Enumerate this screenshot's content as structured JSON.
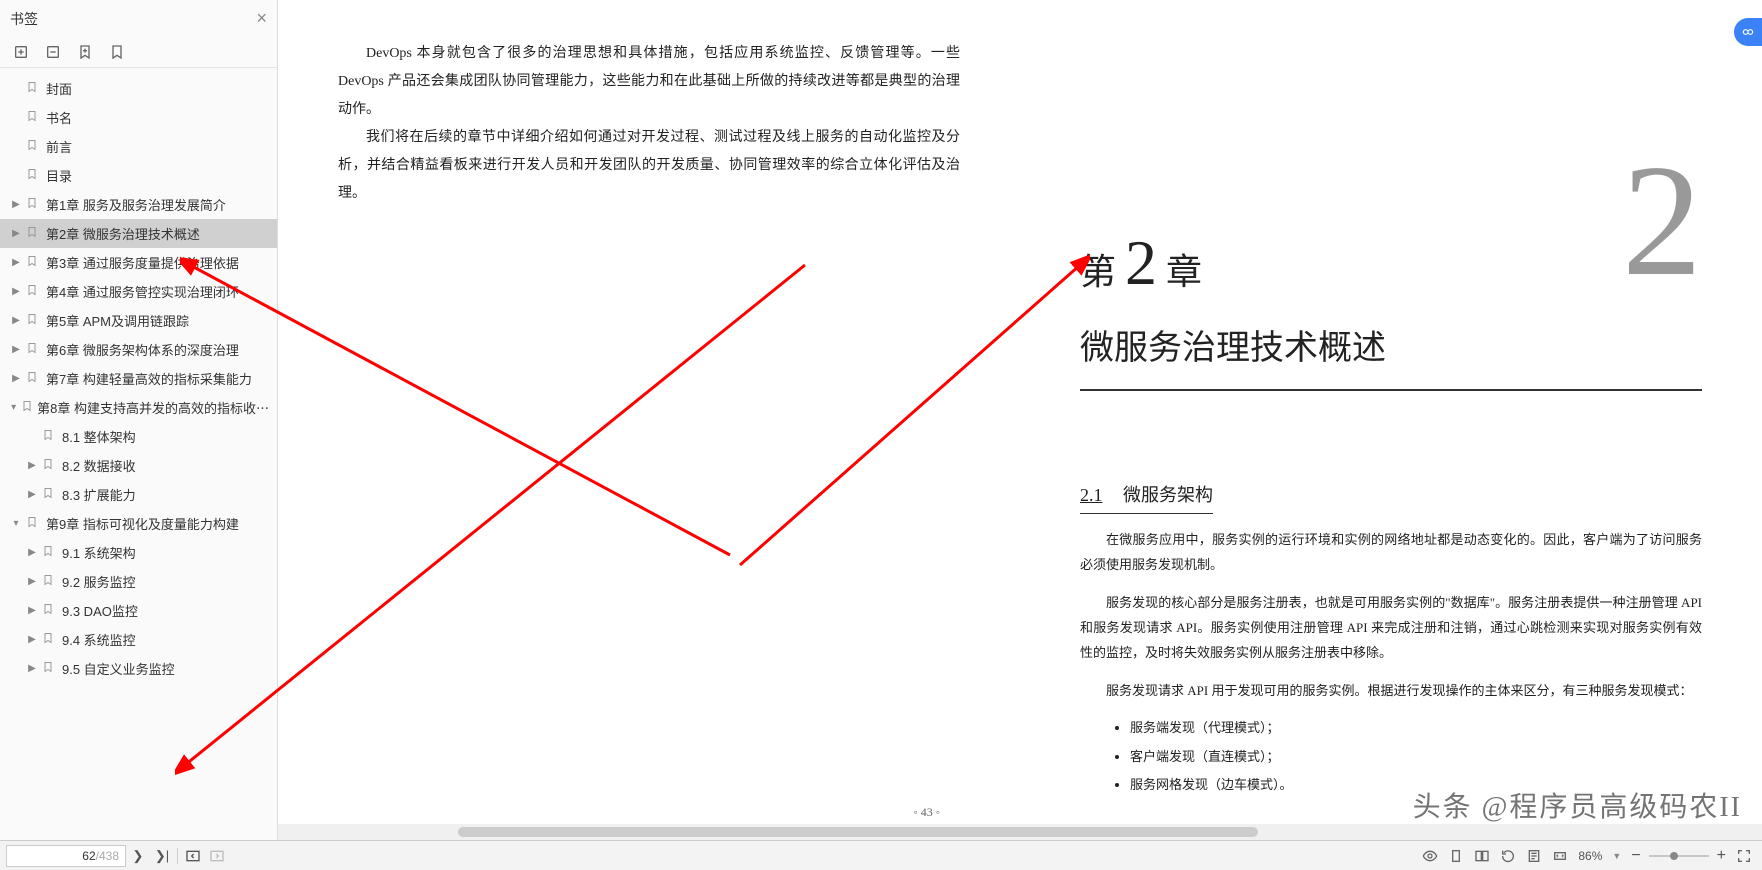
{
  "sidebar": {
    "title": "书签",
    "items": [
      {
        "level": 1,
        "label": "封面",
        "expandable": false
      },
      {
        "level": 1,
        "label": "书名",
        "expandable": false
      },
      {
        "level": 1,
        "label": "前言",
        "expandable": false
      },
      {
        "level": 1,
        "label": "目录",
        "expandable": false
      },
      {
        "level": 1,
        "label": "第1章 服务及服务治理发展简介",
        "expandable": true,
        "arrow": "▶"
      },
      {
        "level": 1,
        "label": "第2章 微服务治理技术概述",
        "expandable": true,
        "arrow": "▶",
        "selected": true
      },
      {
        "level": 1,
        "label": "第3章 通过服务度量提供治理依据",
        "expandable": true,
        "arrow": "▶"
      },
      {
        "level": 1,
        "label": "第4章 通过服务管控实现治理闭环",
        "expandable": true,
        "arrow": "▶"
      },
      {
        "level": 1,
        "label": "第5章 APM及调用链跟踪",
        "expandable": true,
        "arrow": "▶"
      },
      {
        "level": 1,
        "label": "第6章 微服务架构体系的深度治理",
        "expandable": true,
        "arrow": "▶"
      },
      {
        "level": 1,
        "label": "第7章 构建轻量高效的指标采集能力",
        "expandable": true,
        "arrow": "▶"
      },
      {
        "level": 1,
        "label": "第8章 构建支持高并发的高效的指标收⋯",
        "expandable": true,
        "arrow": "▾"
      },
      {
        "level": 2,
        "label": "8.1 整体架构",
        "expandable": false
      },
      {
        "level": 2,
        "label": "8.2 数据接收",
        "expandable": true,
        "arrow": "▶"
      },
      {
        "level": 2,
        "label": "8.3 扩展能力",
        "expandable": true,
        "arrow": "▶"
      },
      {
        "level": 1,
        "label": "第9章 指标可视化及度量能力构建",
        "expandable": true,
        "arrow": "▾"
      },
      {
        "level": 2,
        "label": "9.1 系统架构",
        "expandable": true,
        "arrow": "▶"
      },
      {
        "level": 2,
        "label": "9.2 服务监控",
        "expandable": true,
        "arrow": "▶"
      },
      {
        "level": 2,
        "label": "9.3 DAO监控",
        "expandable": true,
        "arrow": "▶"
      },
      {
        "level": 2,
        "label": "9.4 系统监控",
        "expandable": true,
        "arrow": "▶"
      },
      {
        "level": 2,
        "label": "9.5 自定义业务监控",
        "expandable": true,
        "arrow": "▶"
      }
    ]
  },
  "page_left": {
    "p1": "DevOps 本身就包含了很多的治理思想和具体措施，包括应用系统监控、反馈管理等。一些 DevOps 产品还会集成团队协同管理能力，这些能力和在此基础上所做的持续改进等都是典型的治理动作。",
    "p2": "我们将在后续的章节中详细介绍如何通过对开发过程、测试过程及线上服务的自动化监控及分析，并结合精益看板来进行开发人员和开发团队的开发质量、协同管理效率的综合立体化评估及治理。",
    "page_num": "◦   43   ◦"
  },
  "page_right": {
    "chapter_prefix": "第",
    "chapter_num": "2",
    "chapter_suffix": "章",
    "big_num": "2",
    "chapter_title": "微服务治理技术概述",
    "section_num": "2.1",
    "section_title": "微服务架构",
    "p1": "在微服务应用中，服务实例的运行环境和实例的网络地址都是动态变化的。因此，客户端为了访问服务必须使用服务发现机制。",
    "p2": "服务发现的核心部分是服务注册表，也就是可用服务实例的\"数据库\"。服务注册表提供一种注册管理 API 和服务发现请求 API。服务实例使用注册管理 API 来完成注册和注销，通过心跳检测来实现对服务实例有效性的监控，及时将失效服务实例从服务注册表中移除。",
    "p3": "服务发现请求 API 用于发现可用的服务实例。根据进行发现操作的主体来区分，有三种服务发现模式：",
    "bullets": [
      "服务端发现（代理模式）；",
      "客户端发现（直连模式）；",
      "服务网格发现（边车模式）。"
    ]
  },
  "watermark": "头条 @程序员高级码农II",
  "bottom": {
    "current_page": "62",
    "total_pages": "/438",
    "zoom": "86%"
  }
}
